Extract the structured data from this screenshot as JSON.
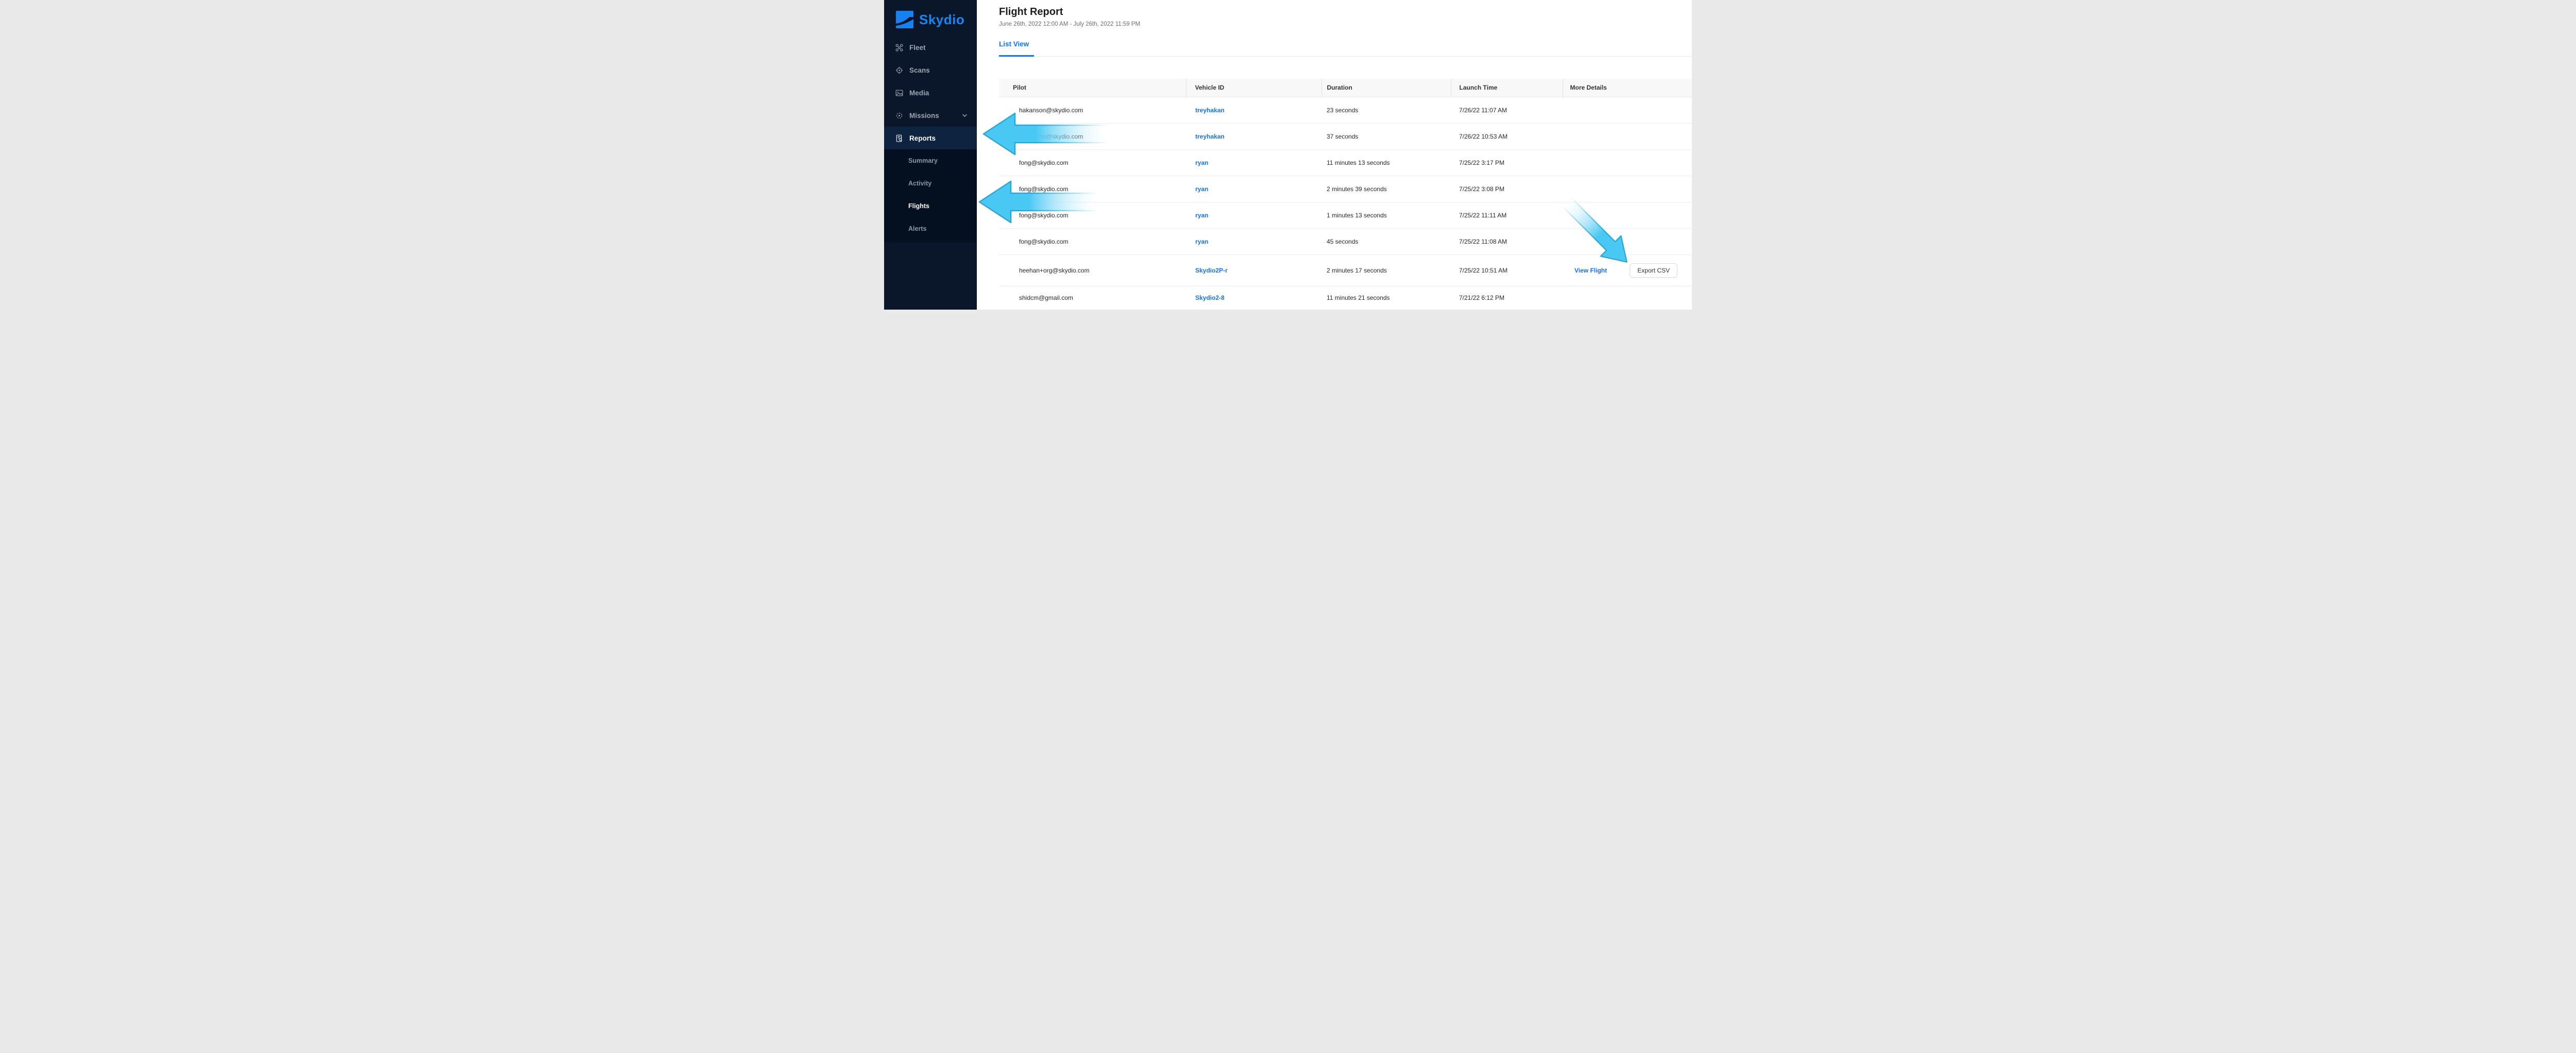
{
  "sidebar": {
    "logo_text": "Skydio",
    "items": [
      {
        "label": "Fleet",
        "icon": "drone-icon"
      },
      {
        "label": "Scans",
        "icon": "scan-icon"
      },
      {
        "label": "Media",
        "icon": "media-icon"
      },
      {
        "label": "Missions",
        "icon": "missions-icon",
        "chevron": true
      },
      {
        "label": "Reports",
        "icon": "reports-icon",
        "active": true,
        "highlighted": true
      }
    ],
    "submenu": [
      {
        "label": "Summary"
      },
      {
        "label": "Activity"
      },
      {
        "label": "Flights",
        "active": true
      },
      {
        "label": "Alerts"
      }
    ]
  },
  "header": {
    "title": "Flight Report",
    "date_range": "June 26th, 2022 12:00 AM - July 26th, 2022 11:59 PM"
  },
  "tabs": {
    "list_view": "List View"
  },
  "table": {
    "columns": [
      "Pilot",
      "Vehicle ID",
      "Duration",
      "Launch Time",
      "More Details"
    ],
    "rows": [
      {
        "pilot": "hakanson@skydio.com",
        "vehicle_id": "treyhakan",
        "duration": "23 seconds",
        "launch_time": "7/26/22 11:07 AM"
      },
      {
        "pilot": "hakanson@skydio.com",
        "vehicle_id": "treyhakan",
        "duration": "37 seconds",
        "launch_time": "7/26/22 10:53 AM"
      },
      {
        "pilot": "fong@skydio.com",
        "vehicle_id": "ryan",
        "duration": "11 minutes 13 seconds",
        "launch_time": "7/25/22 3:17 PM"
      },
      {
        "pilot": "fong@skydio.com",
        "vehicle_id": "ryan",
        "duration": "2 minutes 39 seconds",
        "launch_time": "7/25/22 3:08 PM"
      },
      {
        "pilot": "fong@skydio.com",
        "vehicle_id": "ryan",
        "duration": "1 minutes 13 seconds",
        "launch_time": "7/25/22 11:11 AM"
      },
      {
        "pilot": "fong@skydio.com",
        "vehicle_id": "ryan",
        "duration": "45 seconds",
        "launch_time": "7/25/22 11:08 AM"
      },
      {
        "pilot": "heehan+org@skydio.com",
        "vehicle_id": "Skydio2P-r",
        "duration": "2 minutes 17 seconds",
        "launch_time": "7/25/22 10:51 AM",
        "view_flight": "View Flight",
        "export_csv": "Export CSV"
      },
      {
        "pilot": "shidcm@gmail.com",
        "vehicle_id": "Skydio2-8",
        "duration": "11 minutes 21 seconds",
        "launch_time": "7/21/22 6:12 PM"
      }
    ]
  },
  "annotations": {
    "arrow_color": "#4ac8f4",
    "arrow_outline": "#2aa6d4",
    "targets": [
      "Reports",
      "Flights",
      "Export CSV"
    ]
  },
  "colors": {
    "sidebar_bg": "#0a1629",
    "sidebar_highlight": "#0e2340",
    "submenu_bg": "#04101f",
    "link_blue": "#1672ec",
    "logo_blue": "#1787f1"
  }
}
